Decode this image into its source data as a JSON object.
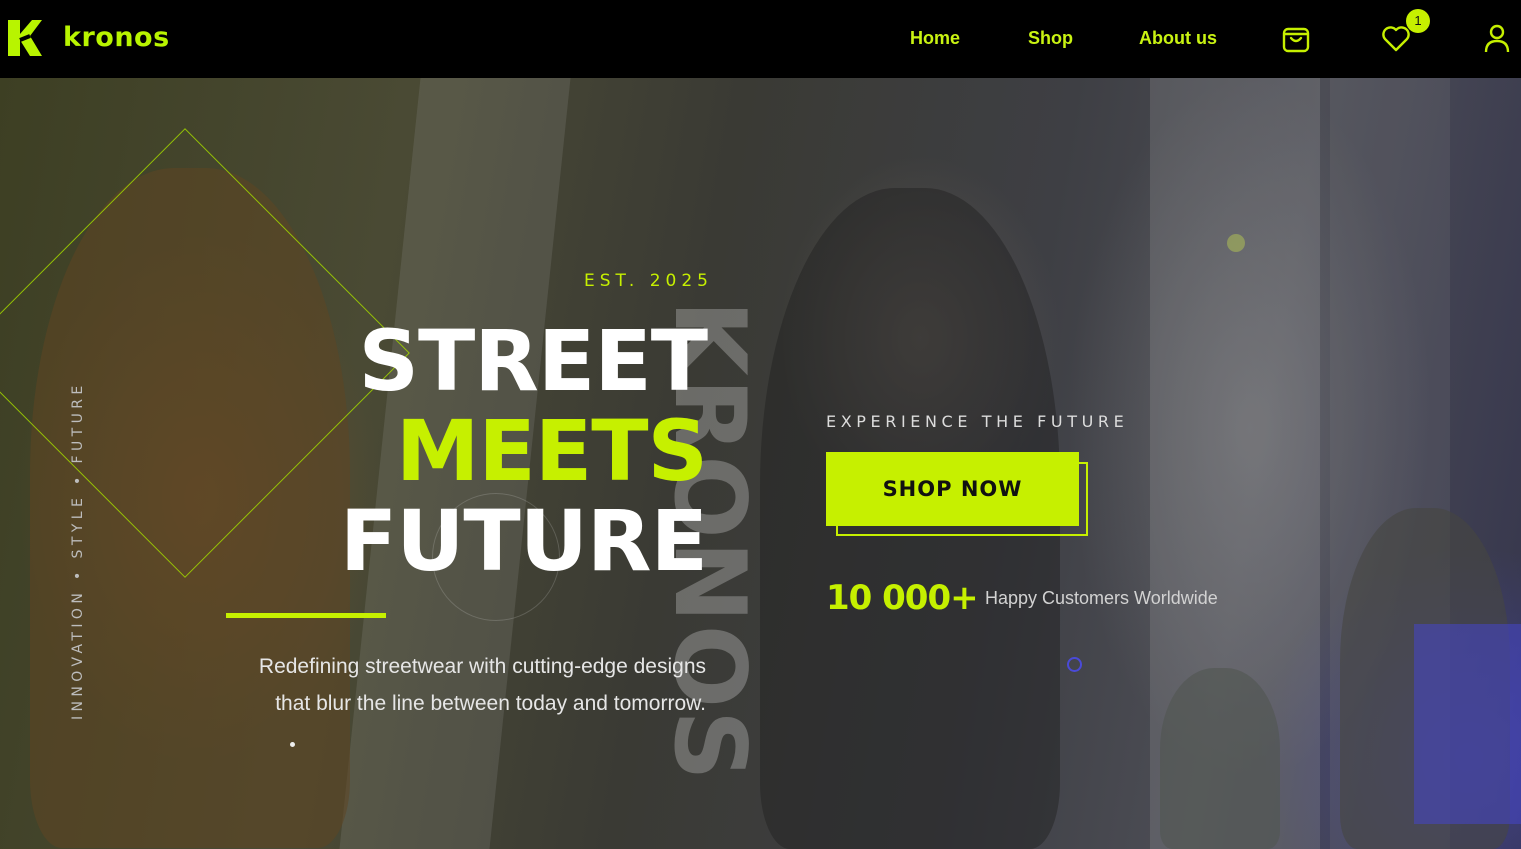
{
  "header": {
    "brand": "kronos",
    "nav": [
      {
        "label": "Home"
      },
      {
        "label": "Shop"
      },
      {
        "label": "About us"
      }
    ],
    "wishlist_count": "1",
    "icons": [
      "cart-icon",
      "heart-icon",
      "user-icon"
    ]
  },
  "hero": {
    "est": "EST. 2025",
    "vertical_tagline": "INNOVATION • STYLE • FUTURE",
    "watermark": "KRONOS",
    "headline": {
      "line1": "STREET",
      "line2": "MEETS",
      "line3": "FUTURE"
    },
    "description": "Redefining streetwear with cutting-edge designs that blur the line between today and tomorrow.",
    "tagline": "EXPERIENCE THE FUTURE",
    "cta": "SHOP NOW",
    "stat_value": "10 000+",
    "stat_label": "Happy Customers Worldwide"
  },
  "colors": {
    "accent": "#c6f000",
    "nav_bg": "#000000",
    "text_light": "#ffffff"
  }
}
